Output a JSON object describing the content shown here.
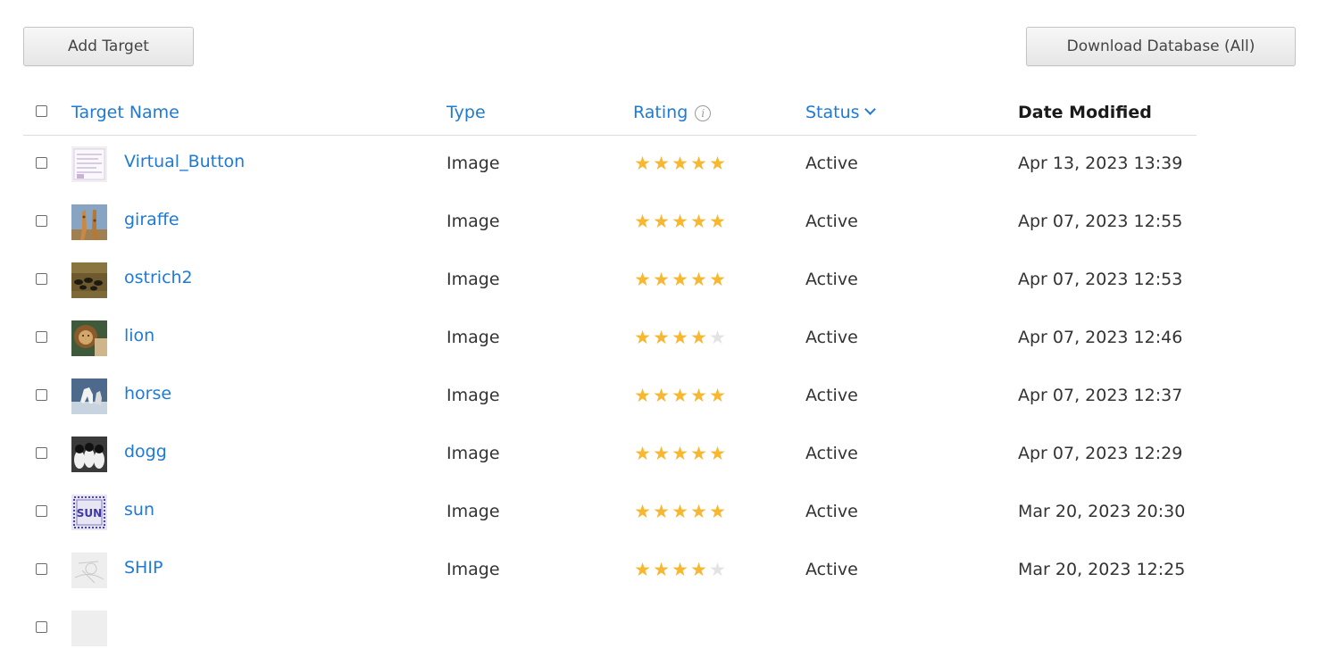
{
  "toolbar": {
    "add_target_label": "Add Target",
    "download_label": "Download Database (All)"
  },
  "table": {
    "headers": {
      "name": "Target Name",
      "type": "Type",
      "rating": "Rating",
      "status": "Status",
      "date": "Date Modified"
    },
    "rows": [
      {
        "name": "Virtual_Button",
        "type": "Image",
        "rating": 5,
        "status": "Active",
        "date": "Apr 13, 2023 13:39"
      },
      {
        "name": "giraffe",
        "type": "Image",
        "rating": 5,
        "status": "Active",
        "date": "Apr 07, 2023 12:55"
      },
      {
        "name": "ostrich2",
        "type": "Image",
        "rating": 5,
        "status": "Active",
        "date": "Apr 07, 2023 12:53"
      },
      {
        "name": "lion",
        "type": "Image",
        "rating": 4,
        "status": "Active",
        "date": "Apr 07, 2023 12:46"
      },
      {
        "name": "horse",
        "type": "Image",
        "rating": 5,
        "status": "Active",
        "date": "Apr 07, 2023 12:37"
      },
      {
        "name": "dogg",
        "type": "Image",
        "rating": 5,
        "status": "Active",
        "date": "Apr 07, 2023 12:29"
      },
      {
        "name": "sun",
        "type": "Image",
        "rating": 5,
        "status": "Active",
        "date": "Mar 20, 2023 20:30"
      },
      {
        "name": "SHIP",
        "type": "Image",
        "rating": 4,
        "status": "Active",
        "date": "Mar 20, 2023 12:25"
      }
    ]
  },
  "colors": {
    "link": "#1f7ad4",
    "star_on": "#f7b731",
    "star_off": "#e3e3e3"
  },
  "icons": {
    "rating_info": "info-circle-icon",
    "status_sort": "chevron-down-icon"
  }
}
